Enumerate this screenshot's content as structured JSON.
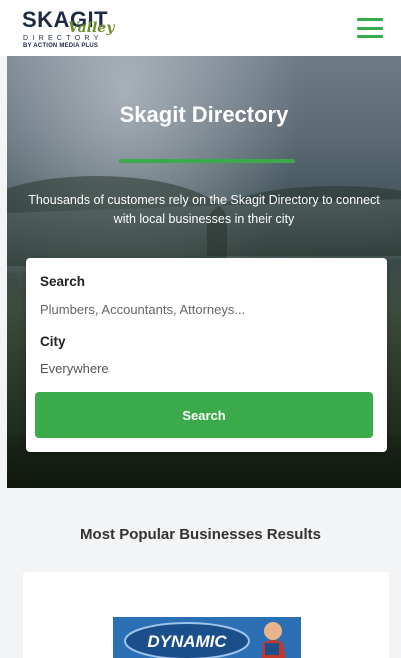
{
  "header": {
    "logo_main": "SKAGIT",
    "logo_script": "Valley",
    "logo_sub1": "DIRECTORY",
    "logo_sub2": "BY ACTION MEDIA PLUS",
    "menu_icon": "hamburger-menu-icon"
  },
  "hero": {
    "title": "Skagit Directory",
    "description": "Thousands of customers rely on the Skagit Directory to connect with local businesses in their city"
  },
  "search": {
    "search_label": "Search",
    "search_placeholder": "Plumbers, Accountants, Attorneys...",
    "city_label": "City",
    "city_value": "Everywhere",
    "button_label": "Search"
  },
  "popular": {
    "title": "Most Popular Businesses Results",
    "first_business_logo_text": "DYNAMIC"
  },
  "colors": {
    "accent": "#3aaa4a",
    "logo_dark": "#1f2a44",
    "logo_green": "#6b8f2a"
  }
}
